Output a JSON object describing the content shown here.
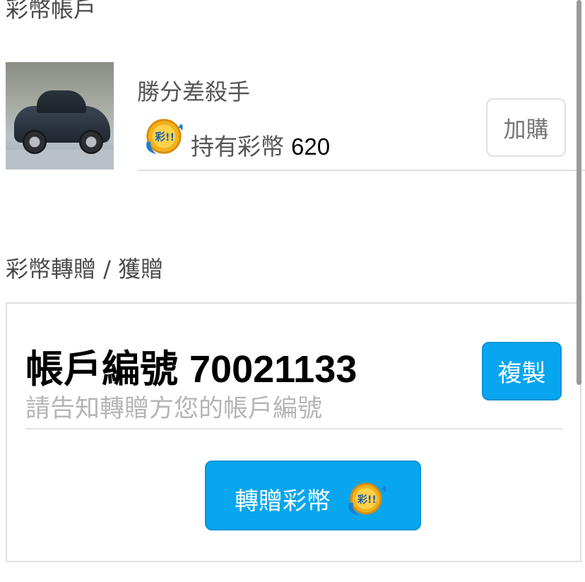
{
  "sections": {
    "account_title": "彩幣帳戶",
    "transfer_title": "彩幣轉贈 / 獲贈"
  },
  "profile": {
    "nickname": "勝分差殺手",
    "holding_label": "持有彩幣",
    "holding_count": "620",
    "buy_button": "加購"
  },
  "transfer": {
    "account_label": "帳戶編號",
    "account_number": "70021133",
    "hint": "請告知轉贈方您的帳戶編號",
    "copy_button": "複製",
    "transfer_button": "轉贈彩幣"
  },
  "icons": {
    "avatar": "car-photo",
    "coin": "lottery-coin-icon",
    "coin_letters": "彩!!"
  },
  "colors": {
    "accent": "#08a6ef",
    "coin_gold": "#f2b21c",
    "coin_blue": "#1d7fd1"
  }
}
